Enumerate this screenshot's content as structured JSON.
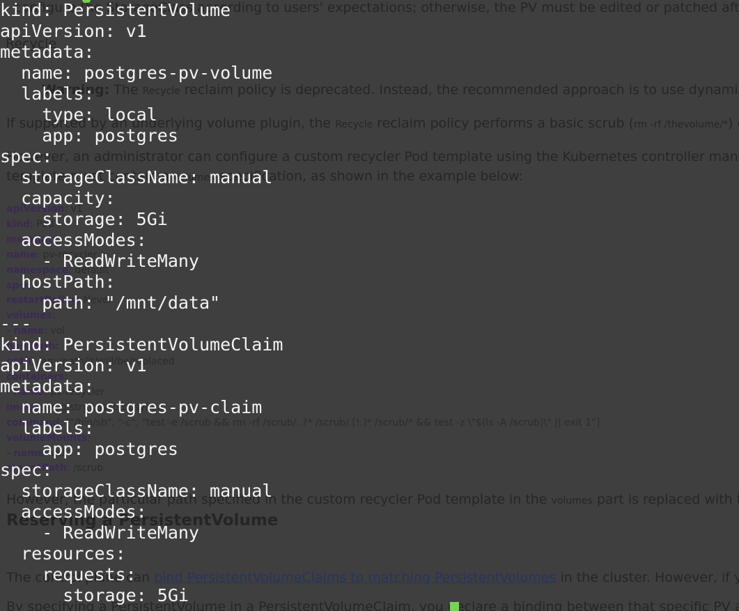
{
  "doc": {
    "line1": "configure the StorageClass according to users' expectations; otherwise, the PV must be edited or patched after it",
    "line_recycle": "Recycle",
    "warning_label": "Warning:",
    "warning_pre": "The",
    "warning_code": "Recycle",
    "warning_post": "reclaim policy is deprecated. Instead, the recommended approach is to use dynamic pr",
    "supported_pre": "If supported by an underlying volume plugin, the",
    "supported_code": "Recycle",
    "supported_mid": "reclaim policy performs a basic scrub (",
    "supported_code2": "rm -rf /thevolume/*",
    "supported_post": ") o",
    "admin_line": "However, an administrator can configure a custom recycler Pod template using the Kubernetes controller manag",
    "template_pre": "template must contain a",
    "template_code": "volumes",
    "template_post": "specification, as shown in the example below:",
    "yaml": [
      {
        "key": "apiVersion",
        "val": ": v1"
      },
      {
        "key": "kind",
        "val": ": Pod"
      },
      {
        "key": "metadata",
        "val": ":"
      },
      {
        "key": "  name",
        "val": ": pv-recycler"
      },
      {
        "key": "  namespace",
        "val": ": default"
      },
      {
        "key": "spec",
        "val": ":"
      },
      {
        "key": "  restartPolicy",
        "val": ": Never"
      },
      {
        "key": "  volumes",
        "val": ":"
      },
      {
        "key": "  - name",
        "val": ": vol"
      },
      {
        "key": "    hostPath",
        "val": ":"
      },
      {
        "key": "      path",
        "val": ": /any/path/it/will/be/replaced"
      },
      {
        "key": "  containers",
        "val": ":"
      },
      {
        "key": "  - name",
        "val": ": pv-recycler"
      },
      {
        "key": "    image",
        "val": ": \"registry.k8s.io/busybox\""
      },
      {
        "key": "    command",
        "val": ": [\"/bin/sh\", \"-c\", \"test -e /scrub && rm -rf /scrub/..?* /scrub/.[!.]* /scrub/*  && test -z \\\"$(ls -A /scrub)\\\" || exit 1\"]"
      },
      {
        "key": "    volumeMounts",
        "val": ":"
      },
      {
        "key": "    - name",
        "val": ": vol"
      },
      {
        "key": "      mountPath",
        "val": ": /scrub"
      }
    ],
    "however_pre": "However, the particular path specified in the custom recycler Pod template in the",
    "however_code": "volumes",
    "however_post": "part is replaced with the",
    "heading": "Reserving a PersistentVolume",
    "control_pre": "The control plane can",
    "control_link": "bind PersistentVolumeClaims to matching PersistentVolumes",
    "control_post": "in the cluster. However, if yo",
    "specifying": "By specifying a PersistentVolume in a PersistentVolumeClaim, you declare a binding between that specific PV an"
  },
  "terminal": {
    "lines": [
      "kind: PersistentVolume",
      "apiVersion: v1",
      "metadata:",
      "  name: postgres-pv-volume",
      "  labels:",
      "    type: local",
      "    app: postgres",
      "spec:",
      "  storageClassName: manual",
      "  capacity:",
      "    storage: 5Gi",
      "  accessModes:",
      "    - ReadWriteMany",
      "  hostPath:",
      "    path: \"/mnt/data\"",
      "---",
      "kind: PersistentVolumeClaim",
      "apiVersion: v1",
      "metadata:",
      "  name: postgres-pv-claim",
      "  labels:",
      "    app: postgres",
      "spec:",
      "  storageClassName: manual",
      "  accessModes:",
      "    - ReadWriteMany",
      "  resources:",
      "    requests:",
      "      storage: 5Gi"
    ]
  },
  "colors": {
    "background": "#3f3f3f",
    "terminal_text": "#f3f3f3",
    "cursor": "#79d25a"
  }
}
